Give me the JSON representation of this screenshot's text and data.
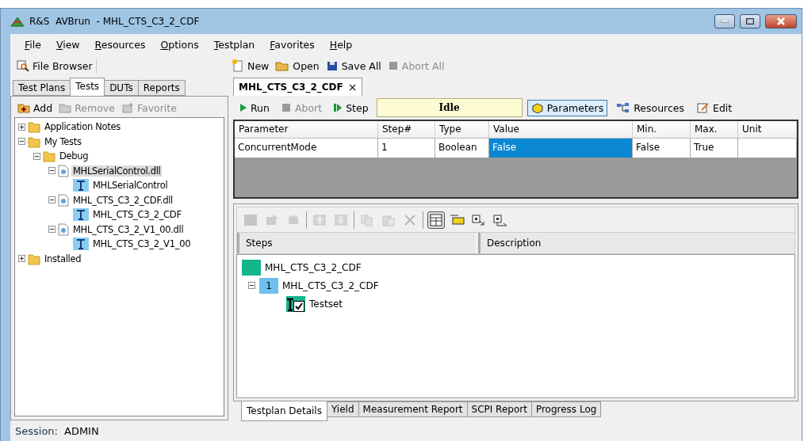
{
  "window": {
    "title": "R&S  AVBrun  - MHL_CTS_C3_2_CDF"
  },
  "menu": [
    "File",
    "View",
    "Resources",
    "Options",
    "Testplan",
    "Favorites",
    "Help"
  ],
  "file_browser": {
    "label": "File Browser"
  },
  "main_toolbar": [
    {
      "kind": "new",
      "label": "New",
      "disabled": false
    },
    {
      "kind": "open",
      "label": "Open",
      "disabled": false
    },
    {
      "kind": "save",
      "label": "Save All",
      "disabled": false
    },
    {
      "kind": "abort",
      "label": "Abort All",
      "disabled": true
    }
  ],
  "left_tabs": [
    {
      "label": "Test Plans",
      "selected": false
    },
    {
      "label": "Tests",
      "selected": true
    },
    {
      "label": "DUTs",
      "selected": false
    },
    {
      "label": "Reports",
      "selected": false
    }
  ],
  "left_toolbar": [
    {
      "kind": "add",
      "label": "Add",
      "disabled": false
    },
    {
      "kind": "remove",
      "label": "Remove",
      "disabled": true
    },
    {
      "kind": "favorite",
      "label": "Favorite",
      "disabled": true
    }
  ],
  "tree": [
    {
      "kind": "folder",
      "label": "Application Notes",
      "expanded": false,
      "selected": false
    },
    {
      "kind": "folder",
      "label": "My Tests",
      "expanded": true,
      "selected": false,
      "children": [
        {
          "kind": "folder",
          "label": "Debug",
          "expanded": true,
          "selected": false,
          "children": [
            {
              "kind": "dll",
              "label": "MHLSerialControl.dll",
              "expanded": true,
              "selected": true,
              "children": [
                {
                  "kind": "test",
                  "label": "MHLSerialControl",
                  "selected": false
                }
              ]
            },
            {
              "kind": "dll",
              "label": "MHL_CTS_C3_2_CDF.dll",
              "expanded": true,
              "selected": false,
              "children": [
                {
                  "kind": "test",
                  "label": "MHL_CTS_C3_2_CDF",
                  "selected": false
                }
              ]
            },
            {
              "kind": "dll",
              "label": "MHL_CTS_C3_2_V1_00.dll",
              "expanded": true,
              "selected": false,
              "children": [
                {
                  "kind": "test",
                  "label": "MHL_CTS_C3_2_V1_00",
                  "selected": false
                }
              ]
            }
          ]
        }
      ]
    },
    {
      "kind": "folder",
      "label": "Installed",
      "expanded": false,
      "selected": false
    }
  ],
  "document_tab": {
    "label": "MHL_CTS_C3_2_CDF",
    "close": "×"
  },
  "run_toolbar": [
    {
      "kind": "run",
      "label": "Run",
      "disabled": false
    },
    {
      "kind": "abort",
      "label": "Abort",
      "disabled": true
    },
    {
      "kind": "step",
      "label": "Step",
      "disabled": false
    }
  ],
  "status": "Idle",
  "view_buttons": [
    {
      "kind": "parameters",
      "label": "Parameters",
      "selected": true
    },
    {
      "kind": "resources",
      "label": "Resources",
      "selected": false
    },
    {
      "kind": "edit",
      "label": "Edit",
      "selected": false
    }
  ],
  "parameters": {
    "columns": [
      "Parameter",
      "Step#",
      "Type",
      "Value",
      "Min.",
      "Max.",
      "Unit"
    ],
    "rows": [
      {
        "cells": [
          {
            "text": "ConcurrentMode",
            "selected": false
          },
          {
            "text": "1",
            "selected": false
          },
          {
            "text": "Boolean",
            "selected": false
          },
          {
            "text": "False",
            "selected": true
          },
          {
            "text": "False",
            "selected": false
          },
          {
            "text": "True",
            "selected": false
          },
          {
            "text": "",
            "selected": false
          }
        ]
      }
    ]
  },
  "steps_toolbar": [
    {
      "kind": "tc",
      "disabled": true
    },
    {
      "kind": "properties",
      "disabled": true
    },
    {
      "kind": "cylinders",
      "disabled": true
    },
    {
      "kind": "sep"
    },
    {
      "kind": "up",
      "disabled": true
    },
    {
      "kind": "down",
      "disabled": true
    },
    {
      "kind": "sep"
    },
    {
      "kind": "copy",
      "disabled": true
    },
    {
      "kind": "paste",
      "disabled": true
    },
    {
      "kind": "delete",
      "disabled": true
    },
    {
      "kind": "sep"
    },
    {
      "kind": "grid",
      "disabled": false,
      "selected": true
    },
    {
      "kind": "card",
      "disabled": false,
      "selected": false
    },
    {
      "kind": "stepin",
      "disabled": false,
      "selected": false
    },
    {
      "kind": "stepout",
      "disabled": false,
      "selected": false
    }
  ],
  "steps_columns": [
    "Steps",
    "Description"
  ],
  "steps": {
    "label": "MHL_CTS_C3_2_CDF",
    "children": [
      {
        "number": "1",
        "label": "MHL_CTS_C3_2_CDF",
        "expanded": true,
        "children": [
          {
            "label": "Testset",
            "checked": true
          }
        ]
      }
    ]
  },
  "bottom_tabs": [
    {
      "label": "Testplan Details",
      "selected": true
    },
    {
      "label": "Yield",
      "selected": false
    },
    {
      "label": "Measurement Report",
      "selected": false
    },
    {
      "label": "SCPI Report",
      "selected": false
    },
    {
      "label": "Progress Log",
      "selected": false
    }
  ],
  "status_bar": {
    "label": "Session:",
    "value": "ADMIN"
  }
}
